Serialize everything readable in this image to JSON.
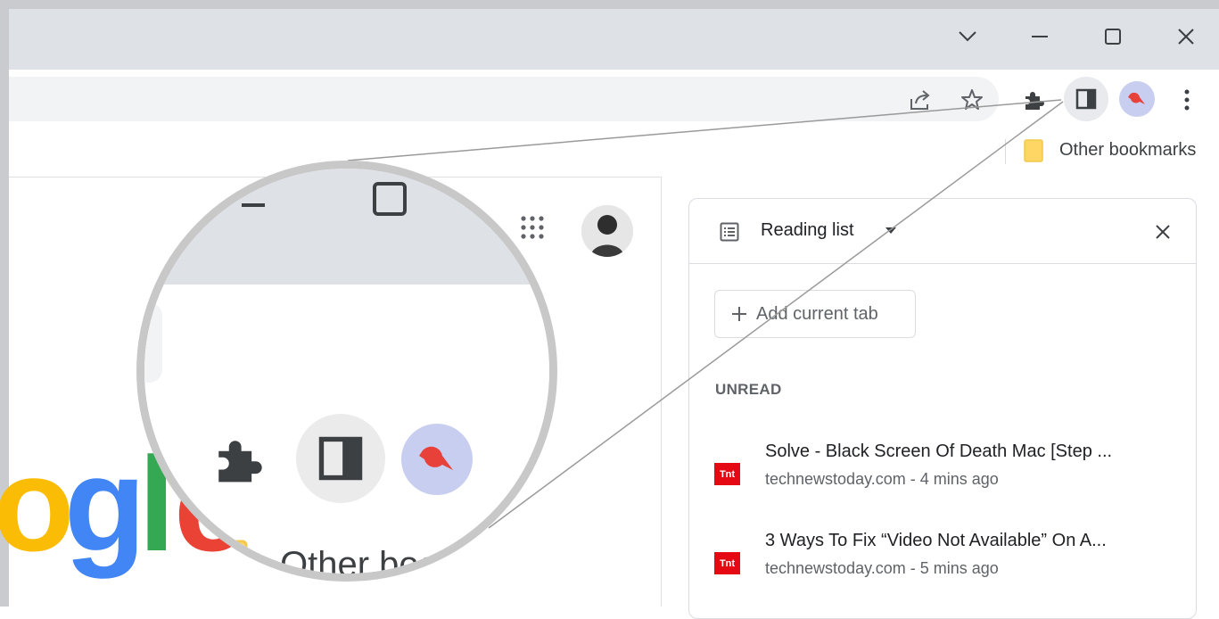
{
  "window": {
    "controls": {
      "tab_search_icon": "chevron-down-icon",
      "minimize_icon": "minimize-icon",
      "maximize_icon": "maximize-icon",
      "close_icon": "close-icon"
    }
  },
  "toolbar": {
    "icons": [
      "share-icon",
      "star-icon",
      "extensions-icon",
      "side-panel-icon",
      "profile-avatar",
      "menu-icon"
    ]
  },
  "bookmarks_bar": {
    "other_bookmarks": "Other bookmarks"
  },
  "google_logo": {
    "letters": [
      {
        "char": "o",
        "color": "#fbbc05"
      },
      {
        "char": "g",
        "color": "#4285f4"
      },
      {
        "char": "l",
        "color": "#34a853"
      },
      {
        "char": "e",
        "color": "#ea4335"
      }
    ]
  },
  "magnifier": {
    "bookmark_label": "Other bookmar"
  },
  "side_panel": {
    "title": "Reading list",
    "add_button": "Add current tab",
    "section_label": "UNREAD",
    "items": [
      {
        "title": "Solve - Black Screen Of Death Mac [Step ...",
        "meta": "technewstoday.com - 4 mins ago",
        "favicon": "Tnt"
      },
      {
        "title": "3 Ways To Fix “Video Not Available” On A...",
        "meta": "technewstoday.com - 5 mins ago",
        "favicon": "Tnt"
      }
    ]
  },
  "colors": {
    "titlebar": "#dee1e6",
    "omnibox": "#f1f3f4",
    "favicon": "#e50914",
    "avatar_bg": "#c8cef0"
  }
}
